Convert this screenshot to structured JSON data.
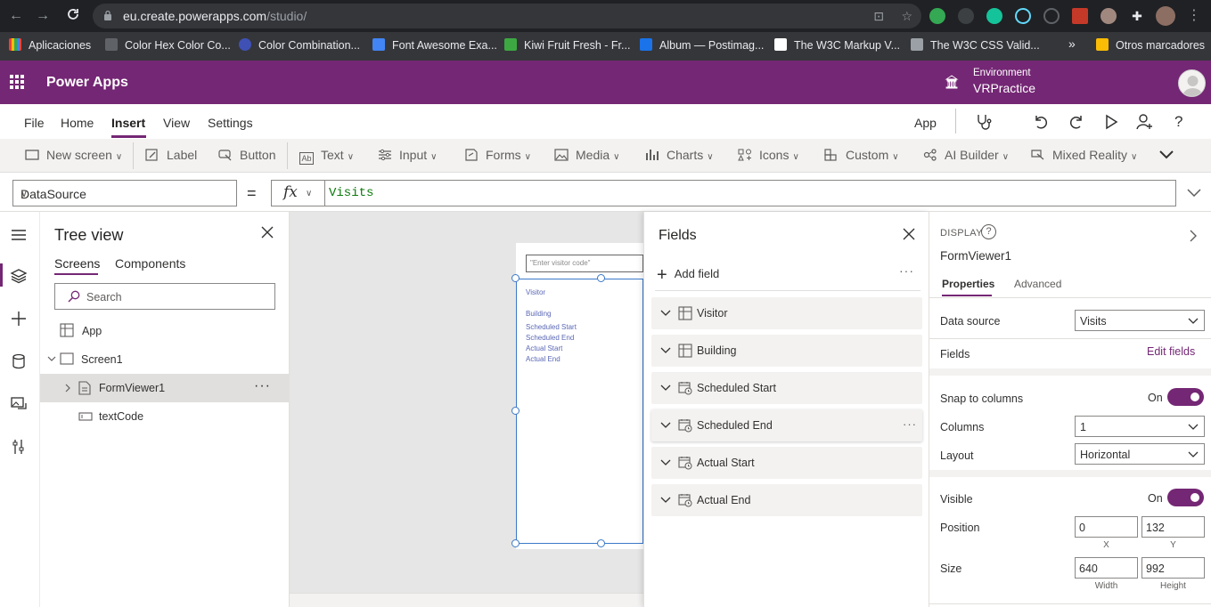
{
  "browser": {
    "url_domain": "eu.create.powerapps.com",
    "url_path": "/studio/",
    "bookmarks": [
      "Aplicaciones",
      "Color Hex Color Co...",
      "Color Combination...",
      "Font Awesome Exa...",
      "Kiwi Fruit Fresh - Fr...",
      "Album — Postimag...",
      "The W3C Markup V...",
      "The W3C CSS Valid...",
      "Otros marcadores"
    ],
    "overflow": "»"
  },
  "header": {
    "app_name": "Power Apps",
    "environment_label": "Environment",
    "environment_name": "VRPractice",
    "brand_color": "#742774"
  },
  "menu": {
    "items": [
      "File",
      "Home",
      "Insert",
      "View",
      "Settings"
    ],
    "active": "Insert",
    "right_label": "App"
  },
  "ribbon": {
    "items": [
      "New screen",
      "Label",
      "Button",
      "Text",
      "Input",
      "Forms",
      "Media",
      "Charts",
      "Icons",
      "Custom",
      "AI Builder",
      "Mixed Reality"
    ]
  },
  "formula": {
    "property": "DataSource",
    "equals": "=",
    "fx": "fx",
    "value": "Visits"
  },
  "tree": {
    "title": "Tree view",
    "tabs": [
      "Screens",
      "Components"
    ],
    "search_placeholder": "Search",
    "items": [
      "App",
      "Screen1",
      "FormViewer1",
      "textCode"
    ],
    "more": "···"
  },
  "canvas": {
    "input_placeholder": "\"Enter visitor code\"",
    "form_fields": [
      "Visitor",
      "Building",
      "Scheduled Start",
      "Scheduled End",
      "Actual Start",
      "Actual End"
    ]
  },
  "fields_pane": {
    "title": "Fields",
    "add_label": "Add field",
    "more": "···",
    "fields": [
      "Visitor",
      "Building",
      "Scheduled Start",
      "Scheduled End",
      "Actual Start",
      "Actual End"
    ]
  },
  "properties": {
    "section": "DISPLAY",
    "help": "?",
    "control_name": "FormViewer1",
    "tabs": [
      "Properties",
      "Advanced"
    ],
    "data_source_label": "Data source",
    "data_source_value": "Visits",
    "fields_label": "Fields",
    "edit_fields_link": "Edit fields",
    "snap_label": "Snap to columns",
    "snap_state": "On",
    "columns_label": "Columns",
    "columns_value": "1",
    "layout_label": "Layout",
    "layout_value": "Horizontal",
    "visible_label": "Visible",
    "visible_state": "On",
    "position_label": "Position",
    "position_x": "0",
    "position_y": "132",
    "x_caption": "X",
    "y_caption": "Y",
    "size_label": "Size",
    "width": "640",
    "height": "992",
    "width_caption": "Width",
    "height_caption": "Height"
  }
}
